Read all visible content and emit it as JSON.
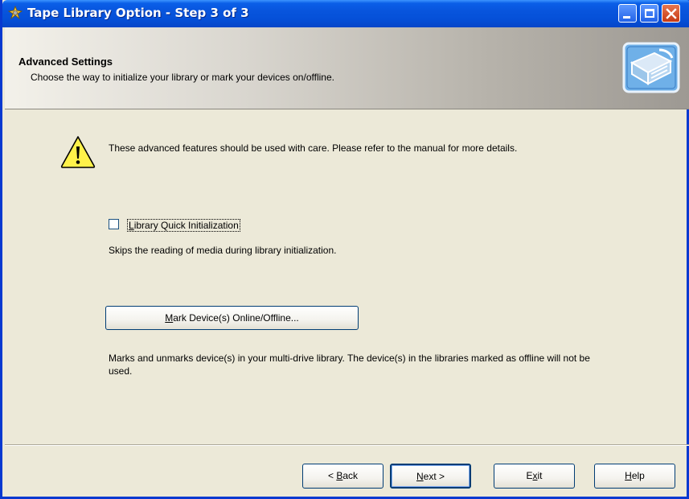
{
  "window": {
    "title": "Tape Library Option - Step 3 of 3"
  },
  "header": {
    "title": "Advanced Settings",
    "subtitle": "Choose the way to initialize your library or mark your devices on/offline."
  },
  "warning": {
    "text": "These advanced features should be used with care. Please refer to the manual for more details."
  },
  "quick_init": {
    "checked": false,
    "label_accel": "L",
    "label_rest": "ibrary Quick Initialization",
    "description": "Skips the reading of media during library initialization."
  },
  "mark_devices": {
    "button_accel": "M",
    "button_rest": "ark Device(s) Online/Offline...",
    "description": "Marks and unmarks device(s) in your multi-drive library. The device(s) in the libraries marked as offline will not be used."
  },
  "footer": {
    "back_pre": "< ",
    "back_accel": "B",
    "back_rest": "ack",
    "next_accel": "N",
    "next_rest": "ext >",
    "exit_pre": "E",
    "exit_accel": "x",
    "exit_rest": "it",
    "help_accel": "H",
    "help_rest": "elp"
  },
  "colors": {
    "titlebar": "#0855dd",
    "face": "#ece9d8",
    "close": "#c63a14"
  }
}
